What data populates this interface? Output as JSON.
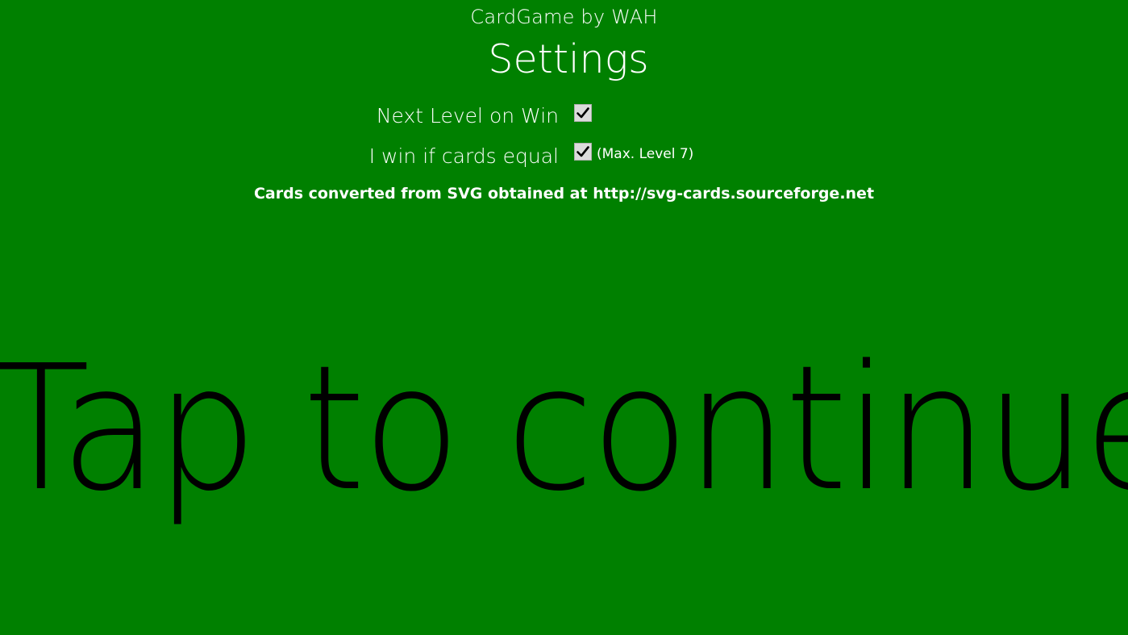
{
  "app": {
    "title": "CardGame by WAH"
  },
  "page": {
    "title": "Settings"
  },
  "settings": {
    "next_level_on_win": {
      "label": "Next Level on Win",
      "checked": true
    },
    "win_if_cards_equal": {
      "label": "I win if cards equal",
      "checked": true,
      "note": "(Max. Level 7)"
    }
  },
  "credits": {
    "text": "Cards converted from SVG obtained at http://svg-cards.sourceforge.net"
  },
  "continue": {
    "label": "Tap to continue"
  },
  "colors": {
    "background": "#008000",
    "text": "#ffffff",
    "continue_text": "#000000",
    "checkbox_fill": "#dcdcdc"
  },
  "icons": {
    "checkbox": "checkmark-icon"
  }
}
